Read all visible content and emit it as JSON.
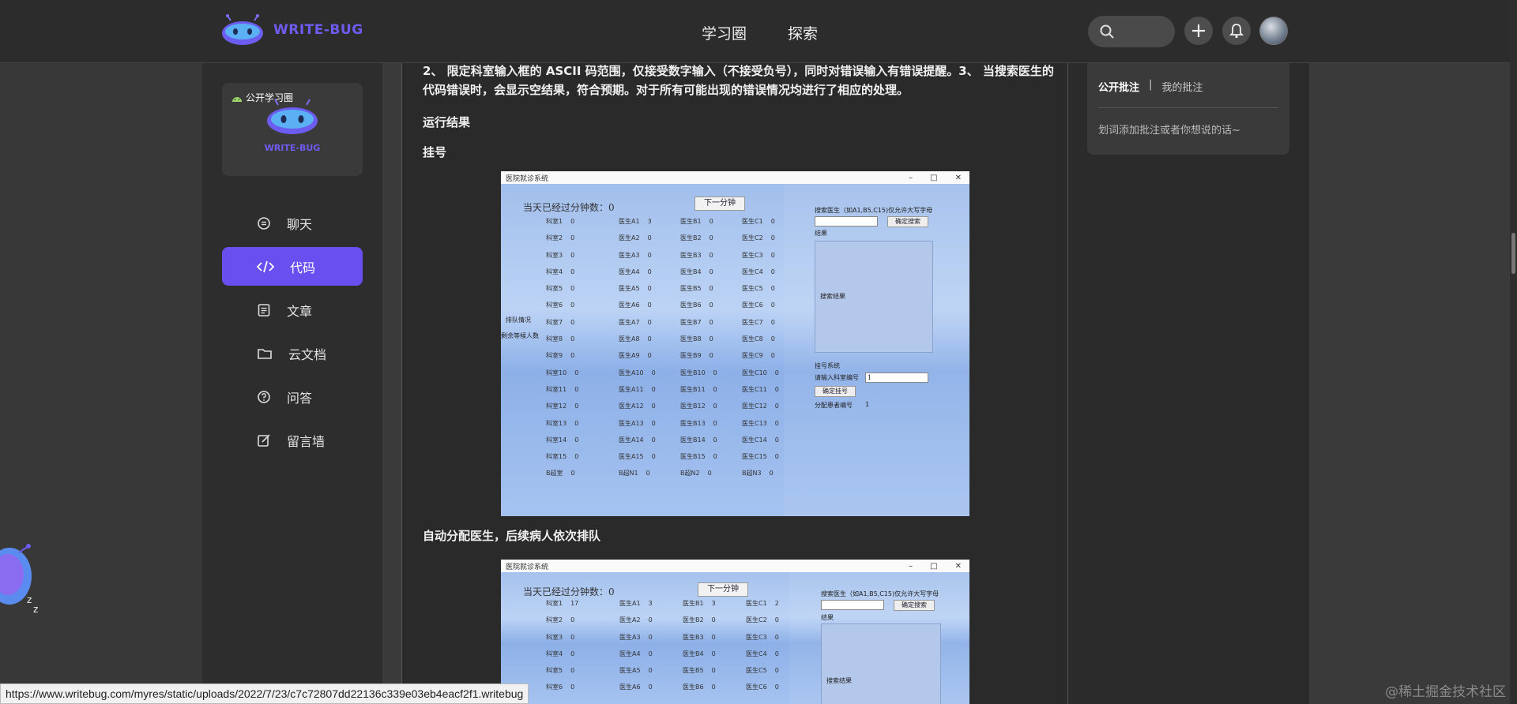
{
  "header": {
    "brand": "WRITE-BUG",
    "nav": [
      "学习圈",
      "探索"
    ]
  },
  "sidebar": {
    "card_pill": "公开学习圈",
    "card_brand": "WRITE-BUG",
    "items": [
      {
        "label": "聊天",
        "icon": "chat-icon",
        "active": false
      },
      {
        "label": "代码",
        "icon": "code-icon",
        "active": true
      },
      {
        "label": "文章",
        "icon": "article-icon",
        "active": false
      },
      {
        "label": "云文档",
        "icon": "folder-icon",
        "active": false
      },
      {
        "label": "问答",
        "icon": "question-icon",
        "active": false
      },
      {
        "label": "留言墙",
        "icon": "edit-icon",
        "active": false
      }
    ]
  },
  "article": {
    "paragraph": "2、 限定科室输入框的 ASCII 码范围，仅接受数字输入（不接受负号），同时对错误输入有错误提醒。3、 当搜索医生的代码错误时，会显示空结果，符合预期。对于所有可能出现的错误情况均进行了相应的处理。",
    "section_run": "运行结果",
    "section_register": "挂号",
    "section_auto": "自动分配医生，后续病人依次排队"
  },
  "screenshot1": {
    "title": "医院就诊系统",
    "minutes": "当天已经过分钟数：0",
    "next_btn": "下一分钟",
    "queue_label": "排队情况",
    "wait_label": "剩余等候人数",
    "rooms": [
      "科室1",
      "科室2",
      "科室3",
      "科室4",
      "科室5",
      "科室6",
      "科室7",
      "科室8",
      "科室9",
      "科室10",
      "科室11",
      "科室12",
      "科室13",
      "科室14",
      "科室15",
      "B超室"
    ],
    "room_vals": [
      "0",
      "0",
      "0",
      "0",
      "0",
      "0",
      "0",
      "0",
      "0",
      "0",
      "0",
      "0",
      "0",
      "0",
      "0",
      "0"
    ],
    "colA": [
      "医生A1",
      "医生A2",
      "医生A3",
      "医生A4",
      "医生A5",
      "医生A6",
      "医生A7",
      "医生A8",
      "医生A9",
      "医生A10",
      "医生A11",
      "医生A12",
      "医生A13",
      "医生A14",
      "医生A15",
      "B超N1"
    ],
    "colA_vals": [
      "3",
      "0",
      "0",
      "0",
      "0",
      "0",
      "0",
      "0",
      "0",
      "0",
      "0",
      "0",
      "0",
      "0",
      "0",
      "0"
    ],
    "colB": [
      "医生B1",
      "医生B2",
      "医生B3",
      "医生B4",
      "医生B5",
      "医生B6",
      "医生B7",
      "医生B8",
      "医生B9",
      "医生B10",
      "医生B11",
      "医生B12",
      "医生B13",
      "医生B14",
      "医生B15",
      "B超N2"
    ],
    "colB_vals": [
      "0",
      "0",
      "0",
      "0",
      "0",
      "0",
      "0",
      "0",
      "0",
      "0",
      "0",
      "0",
      "0",
      "0",
      "0",
      "0"
    ],
    "colC": [
      "医生C1",
      "医生C2",
      "医生C3",
      "医生C4",
      "医生C5",
      "医生C6",
      "医生C7",
      "医生C8",
      "医生C9",
      "医生C10",
      "医生C11",
      "医生C12",
      "医生C13",
      "医生C14",
      "医生C15",
      "B超N3"
    ],
    "colC_vals": [
      "0",
      "0",
      "0",
      "0",
      "0",
      "0",
      "0",
      "0",
      "0",
      "0",
      "0",
      "0",
      "0",
      "0",
      "0",
      "0"
    ],
    "search_label": "搜索医生（如A1,B5,C15)仅允许大写字母",
    "search_btn": "确定搜索",
    "result_label": "结果",
    "result_text": "搜索结果",
    "reg_system": "挂号系统",
    "reg_prompt": "请输入科室编号",
    "reg_value": "1",
    "reg_btn": "确定挂号",
    "patient_no_label": "分配患者编号",
    "patient_no": "1"
  },
  "screenshot2": {
    "title": "医院就诊系统",
    "minutes": "当天已经过分钟数：0",
    "next_btn": "下一分钟",
    "rooms": [
      "科室1",
      "科室2",
      "科室3",
      "科室4",
      "科室5",
      "科室6"
    ],
    "room_vals": [
      "17",
      "0",
      "0",
      "0",
      "0",
      "0"
    ],
    "colA": [
      "医生A1",
      "医生A2",
      "医生A3",
      "医生A4",
      "医生A5",
      "医生A6"
    ],
    "colA_vals": [
      "3",
      "0",
      "0",
      "0",
      "0",
      "0"
    ],
    "colB": [
      "医生B1",
      "医生B2",
      "医生B3",
      "医生B4",
      "医生B5",
      "医生B6"
    ],
    "colB_vals": [
      "3",
      "0",
      "0",
      "0",
      "0",
      "0"
    ],
    "colC": [
      "医生C1",
      "医生C2",
      "医生C3",
      "医生C4",
      "医生C5",
      "医生C6"
    ],
    "colC_vals": [
      "2",
      "0",
      "0",
      "0",
      "0",
      "0"
    ],
    "search_label": "搜索医生（如A1,B5,C15)仅允许大写字母",
    "search_btn": "确定搜索",
    "result_label": "结果",
    "result_text": "搜索结果"
  },
  "annotations": {
    "tab_public": "公开批注",
    "separator": "|",
    "tab_mine": "我的批注",
    "hint": "划词添加批注或者你想说的话~"
  },
  "status_url": "https://www.writebug.com/myres/static/uploads/2022/7/23/c7c72807dd22136c339e03eb4eacf2f1.writebug",
  "watermark": "@稀土掘金技术社区",
  "colors": {
    "accent": "#6a4ff0",
    "topbar": "#2c2c2c",
    "sidebar": "#2d2d2d",
    "content": "#2a2a2a"
  }
}
